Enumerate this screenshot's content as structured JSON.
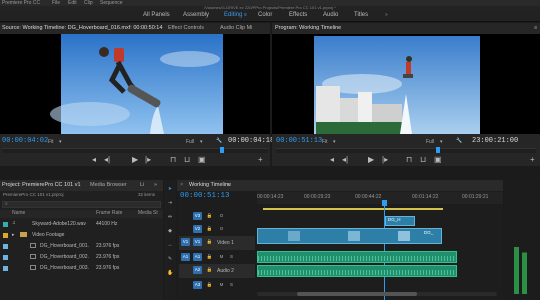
{
  "menubar": {
    "items": [
      "Premiere Pro CC",
      "File",
      "Edit",
      "Clip",
      "Sequence"
    ]
  },
  "path": "/Volumes/G-DRIVE ev 220/PPro Projects/Premiere Pro CC 101 v1.prproj *",
  "workspaces": [
    "All Panels",
    "Assembly",
    "Editing",
    "Color",
    "Effects",
    "Audio",
    "Titles"
  ],
  "active_workspace": "Editing",
  "source": {
    "title": "Source: Working Timeline: DG_Hoverboard_016.mxf: 00:00:50:14",
    "tabs": [
      "Effect Controls",
      "Audio Clip Mi"
    ],
    "timecode_in": "00:00:04:02",
    "timecode_dur": "00:00:04:18",
    "fit": "Fit",
    "quality": "Full"
  },
  "program": {
    "title": "Program: Working Timeline",
    "timecode_in": "00:00:51:13",
    "timecode_dur": "23:00:21:00",
    "fit": "Fit",
    "quality": "Full"
  },
  "project": {
    "title": "Project: PremierePro CC 101 v1",
    "tab2": "Media Browser",
    "tab3": "Li",
    "file": "PremierePro CC 101 v1.prproj",
    "count": "32 items",
    "cols": {
      "name": "Name",
      "frame": "Frame Rate",
      "media": "Media St"
    },
    "items": [
      {
        "name": "Skyward-Adobe120.wav",
        "rate": "44100 Hz"
      },
      {
        "name": "Video Footage",
        "rate": ""
      },
      {
        "name": "DG_Hoverboard_001.",
        "rate": "23.976 fps"
      },
      {
        "name": "DG_Hoverboard_002.",
        "rate": "23.976 fps"
      },
      {
        "name": "DG_Hoverboard_003.",
        "rate": "23.976 fps"
      }
    ]
  },
  "timeline": {
    "title": "Working Timeline",
    "timecode": "00:00:51:13",
    "ruler": [
      "00:00:14:23",
      "00:00:29:23",
      "00:00:44:22",
      "00:01:14:22",
      "00:01:29:21"
    ],
    "tracks": [
      {
        "id": "V3",
        "label": ""
      },
      {
        "id": "V2",
        "label": ""
      },
      {
        "id": "V1",
        "label": "Video 1"
      },
      {
        "id": "A1",
        "label": ""
      },
      {
        "id": "A2",
        "label": "Audio 2"
      },
      {
        "id": "A3",
        "label": ""
      }
    ],
    "v_buttons": [
      "O"
    ],
    "a_buttons": [
      "M",
      "S"
    ],
    "clips": {
      "v3": "DG_H",
      "v1": "DG_"
    }
  },
  "colors": {
    "accent": "#2e9cf0",
    "video_clip": "#2e7fa8",
    "audio_clip": "#1f8f6e"
  }
}
